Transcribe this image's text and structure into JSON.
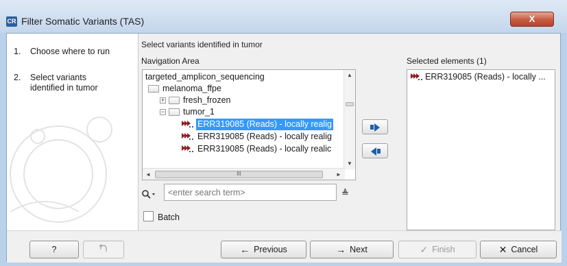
{
  "window": {
    "app_icon": "CR",
    "title": "Filter Somatic Variants (TAS)",
    "close_glyph": "X"
  },
  "steps": [
    {
      "num": "1.",
      "label": "Choose where to run"
    },
    {
      "num": "2.",
      "label": "Select variants identified in tumor"
    }
  ],
  "main": {
    "caption": "Select variants identified in tumor",
    "navigation_label": "Navigation Area",
    "selected_label": "Selected elements (1)"
  },
  "tree": [
    {
      "label": "targeted_amplicon_sequencing",
      "kind": "text"
    },
    {
      "label": "melanoma_ffpe",
      "kind": "folder"
    },
    {
      "label": "fresh_frozen",
      "kind": "folder",
      "expander": "+"
    },
    {
      "label": "tumor_1",
      "kind": "folder",
      "expander": "−"
    },
    {
      "label": "ERR319085 (Reads) - locally realig",
      "kind": "reads",
      "selected": true
    },
    {
      "label": "ERR319085 (Reads) - locally realig",
      "kind": "reads"
    },
    {
      "label": "ERR319085 (Reads) - locally realic",
      "kind": "reads"
    }
  ],
  "search": {
    "placeholder": "<enter search term>",
    "icon": "search-icon",
    "options_glyph": "≜"
  },
  "batch": {
    "label": "Batch",
    "checked": false
  },
  "selected_elements": [
    {
      "label": "ERR319085 (Reads) - locally ..."
    }
  ],
  "scroll_glyphs": {
    "up": "▲",
    "down": "▼",
    "left": "◄",
    "right": "►",
    "grip": "III"
  },
  "buttons": {
    "help": "?",
    "previous": "Previous",
    "next": "Next",
    "finish": "Finish",
    "cancel": "Cancel"
  },
  "colors": {
    "selection": "#3399ff",
    "accent_arrow": "#1d5faa",
    "reads_icon": "#8b1d1d",
    "close": "#c85a41"
  }
}
